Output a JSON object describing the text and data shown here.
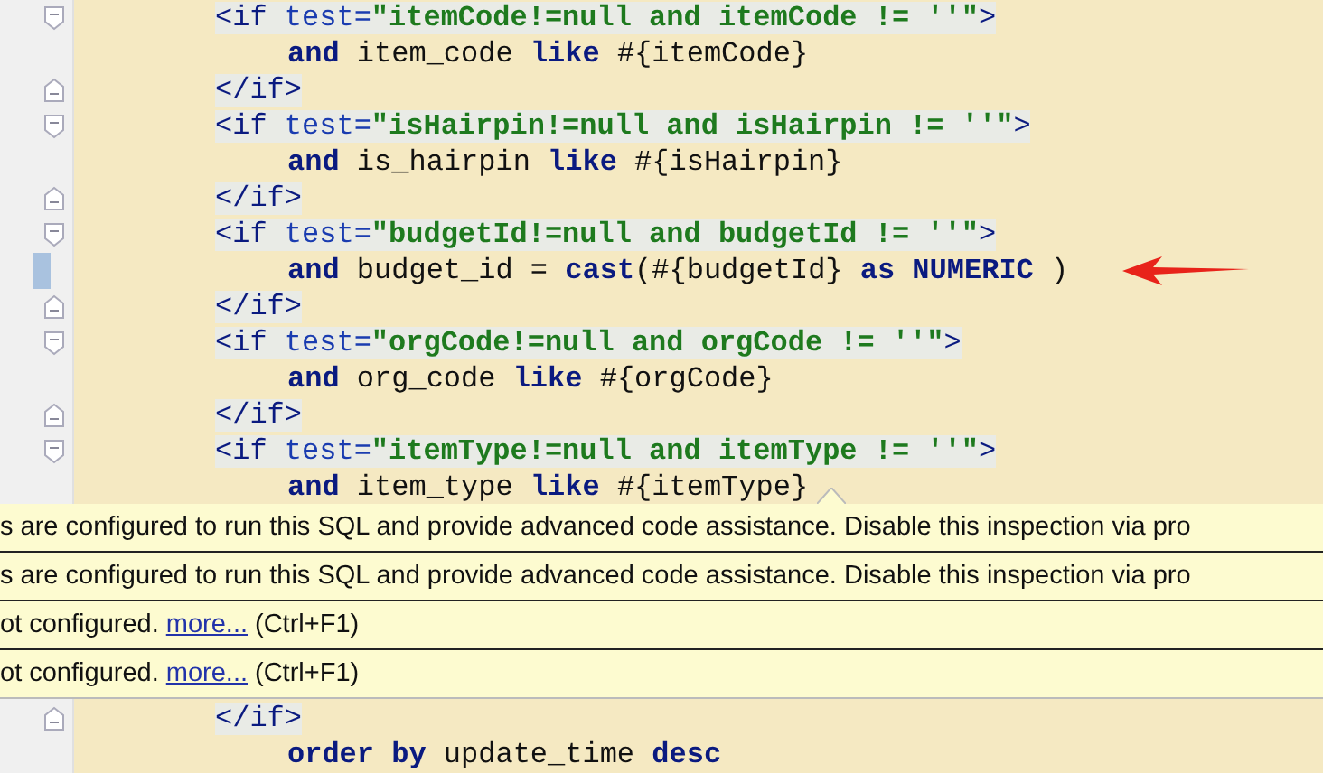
{
  "editor": {
    "blocks": [
      {
        "lines": [
          {
            "kind": "open",
            "tokens": [
              {
                "kind": "tag",
                "text": "<if "
              },
              {
                "kind": "attr",
                "text": "test="
              },
              {
                "kind": "string",
                "text": "\"itemCode!=null and itemCode != ''\""
              },
              {
                "kind": "tag",
                "text": ">"
              }
            ]
          },
          {
            "kind": "sql",
            "tokens": [
              {
                "kind": "keyword",
                "text": "and"
              },
              {
                "kind": "plain",
                "text": " item_code "
              },
              {
                "kind": "keyword",
                "text": "like"
              },
              {
                "kind": "plain",
                "text": " #{itemCode}"
              }
            ]
          },
          {
            "kind": "close",
            "tokens": [
              {
                "kind": "tag",
                "text": "</if>"
              }
            ]
          },
          {
            "kind": "open",
            "tokens": [
              {
                "kind": "tag",
                "text": "<if "
              },
              {
                "kind": "attr",
                "text": "test="
              },
              {
                "kind": "string",
                "text": "\"isHairpin!=null and isHairpin != ''\""
              },
              {
                "kind": "tag",
                "text": ">"
              }
            ]
          },
          {
            "kind": "sql",
            "tokens": [
              {
                "kind": "keyword",
                "text": "and"
              },
              {
                "kind": "plain",
                "text": " is_hairpin "
              },
              {
                "kind": "keyword",
                "text": "like"
              },
              {
                "kind": "plain",
                "text": " #{isHairpin}"
              }
            ]
          },
          {
            "kind": "close",
            "tokens": [
              {
                "kind": "tag",
                "text": "</if>"
              }
            ]
          },
          {
            "kind": "open",
            "tokens": [
              {
                "kind": "tag",
                "text": "<if "
              },
              {
                "kind": "attr",
                "text": "test="
              },
              {
                "kind": "string",
                "text": "\"budgetId!=null and budgetId != ''\""
              },
              {
                "kind": "tag",
                "text": ">"
              }
            ]
          },
          {
            "kind": "sql",
            "current": true,
            "annotated": true,
            "tokens": [
              {
                "kind": "keyword",
                "text": "and"
              },
              {
                "kind": "plain",
                "text": " budget_id = "
              },
              {
                "kind": "keyword",
                "text": "cast"
              },
              {
                "kind": "plain",
                "text": "(#{budgetId} "
              },
              {
                "kind": "keyword",
                "text": "as NUMERIC"
              },
              {
                "kind": "plain",
                "text": " )"
              }
            ]
          },
          {
            "kind": "close",
            "tokens": [
              {
                "kind": "tag",
                "text": "</if>"
              }
            ]
          },
          {
            "kind": "open",
            "tokens": [
              {
                "kind": "tag",
                "text": "<if "
              },
              {
                "kind": "attr",
                "text": "test="
              },
              {
                "kind": "string",
                "text": "\"orgCode!=null and orgCode != ''\""
              },
              {
                "kind": "tag",
                "text": ">"
              }
            ]
          },
          {
            "kind": "sql",
            "tokens": [
              {
                "kind": "keyword",
                "text": "and"
              },
              {
                "kind": "plain",
                "text": " org_code "
              },
              {
                "kind": "keyword",
                "text": "like"
              },
              {
                "kind": "plain",
                "text": " #{orgCode}"
              }
            ]
          },
          {
            "kind": "close",
            "tokens": [
              {
                "kind": "tag",
                "text": "</if>"
              }
            ]
          },
          {
            "kind": "open",
            "tokens": [
              {
                "kind": "tag",
                "text": "<if "
              },
              {
                "kind": "attr",
                "text": "test="
              },
              {
                "kind": "string",
                "text": "\"itemType!=null and itemType != ''\""
              },
              {
                "kind": "tag",
                "text": ">"
              }
            ]
          },
          {
            "kind": "sql",
            "tokens": [
              {
                "kind": "keyword",
                "text": "and"
              },
              {
                "kind": "plain",
                "text": " item_type "
              },
              {
                "kind": "keyword",
                "text": "like"
              },
              {
                "kind": "plain",
                "text": " #{itemType}"
              }
            ]
          }
        ]
      },
      {
        "lines": [
          {
            "kind": "close",
            "tokens": [
              {
                "kind": "tag",
                "text": "</if>"
              }
            ]
          },
          {
            "kind": "sql",
            "tokens": [
              {
                "kind": "keyword",
                "text": "order by"
              },
              {
                "kind": "plain",
                "text": " update_time "
              },
              {
                "kind": "keyword",
                "text": "desc"
              }
            ]
          }
        ]
      }
    ]
  },
  "tooltip": {
    "rows": [
      {
        "text": "s are configured to run this SQL and provide advanced code assistance. Disable this inspection via pro"
      },
      {
        "text": "s are configured to run this SQL and provide advanced code assistance. Disable this inspection via pro"
      },
      {
        "text": "ot configured.",
        "link": "more...",
        "shortcut": "(Ctrl+F1)"
      },
      {
        "text": "ot configured.",
        "link": "more...",
        "shortcut": "(Ctrl+F1)"
      }
    ]
  }
}
